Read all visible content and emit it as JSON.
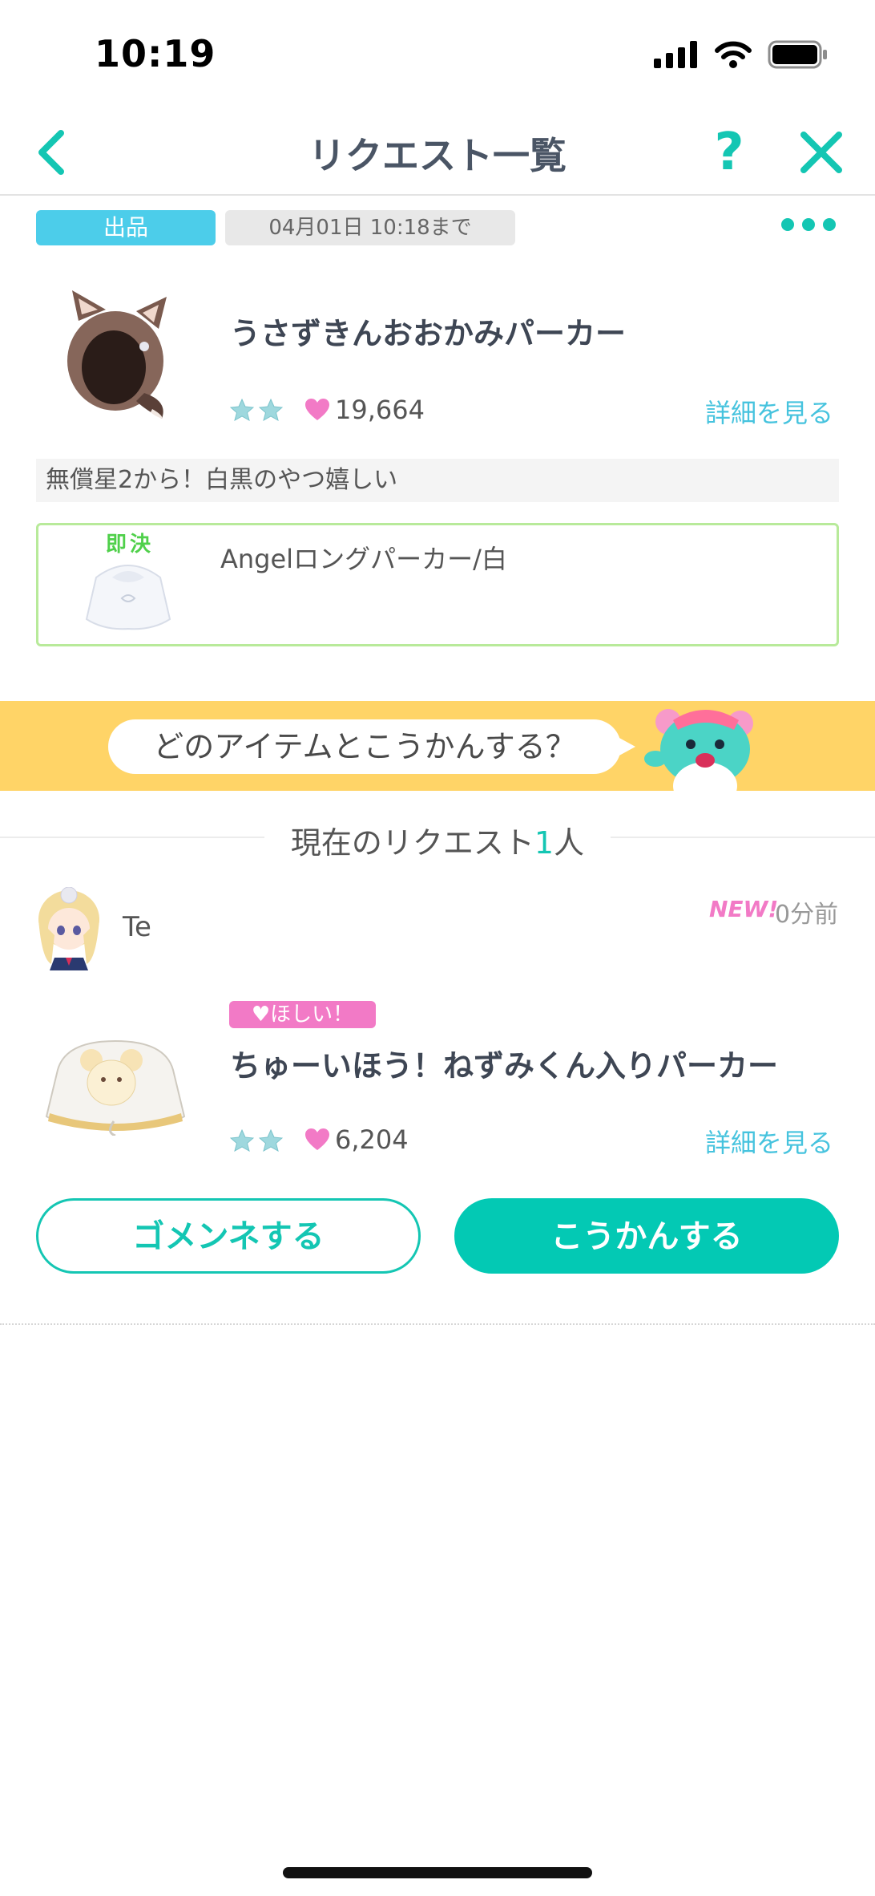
{
  "status_bar": {
    "time": "10:19"
  },
  "nav": {
    "title": "リクエスト一覧",
    "help": "?"
  },
  "listing": {
    "badge": "出品",
    "deadline": "04月01日 10:18まで",
    "item_name": "うさずきんおおかみパーカー",
    "stars": 2,
    "likes": "19,664",
    "detail_link": "詳細を見る",
    "comment": "無償星2から！白黒のやつ嬉しい",
    "instant": {
      "label": "即決",
      "item_name": "Angelロングパーカー/白"
    }
  },
  "banner": {
    "text": "どのアイテムとこうかんする？"
  },
  "requests": {
    "header_prefix": "現在のリクエスト",
    "count": "1",
    "header_suffix": "人",
    "items": [
      {
        "user": "Te",
        "new_badge": "NEW!",
        "time_ago": "0分前",
        "want_badge": "♥ほしい！",
        "item_name": "ちゅーいほう！ねずみくん入りパーカー",
        "stars": 2,
        "likes": "6,204",
        "detail_link": "詳細を見る",
        "decline_label": "ゴメンネする",
        "exchange_label": "こうかんする"
      }
    ]
  },
  "colors": {
    "accent": "#14c6b3",
    "link": "#46c3de",
    "pink": "#f27ac6",
    "banner": "#ffd467"
  }
}
